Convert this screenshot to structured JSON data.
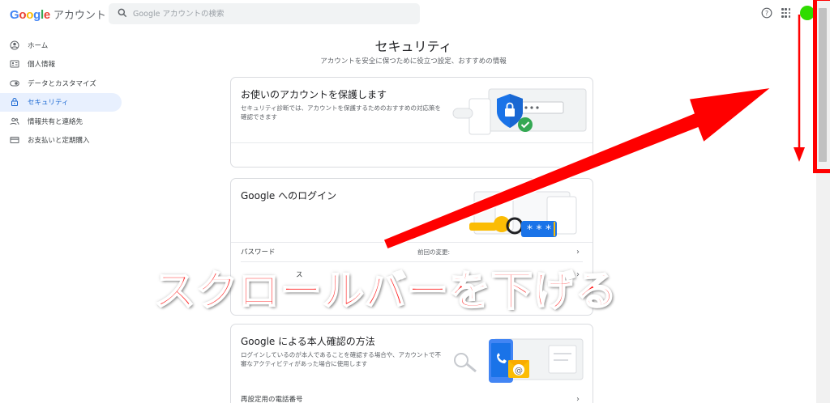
{
  "header": {
    "logo_google": "Google",
    "logo_account": "アカウント",
    "search_placeholder": "Google アカウントの検索"
  },
  "sidebar": {
    "items": [
      {
        "label": "ホーム",
        "icon": "home-icon"
      },
      {
        "label": "個人情報",
        "icon": "id-card-icon"
      },
      {
        "label": "データとカスタマイズ",
        "icon": "toggle-icon"
      },
      {
        "label": "セキュリティ",
        "icon": "lock-icon",
        "active": true
      },
      {
        "label": "情報共有と連絡先",
        "icon": "people-icon"
      },
      {
        "label": "お支払いと定期購入",
        "icon": "credit-card-icon"
      }
    ]
  },
  "main": {
    "title": "セキュリティ",
    "subtitle": "アカウントを安全に保つために役立つ設定、おすすめの情報",
    "cards": [
      {
        "title": "お使いのアカウントを保護します",
        "description": "セキュリティ診断では、アカウントを保護するためのおすすめの対応策を確認できます"
      },
      {
        "title": "Google へのログイン",
        "rows": [
          {
            "label": "パスワード",
            "value": "前回の変更:"
          },
          {
            "label": "ス",
            "value": ""
          }
        ]
      },
      {
        "title": "Google による本人確認の方法",
        "description": "ログインしているのが本人であることを確認する場合や、アカウントで不審なアクティビティがあった場合に使用します",
        "rows": [
          {
            "label": "再設定用の電話番号",
            "value": ""
          }
        ]
      }
    ]
  },
  "annotation": {
    "text": "スクロールバーを下げる",
    "color": "#ff0000"
  },
  "colors": {
    "accent": "#1a73e8",
    "active_bg": "#e8f0fe",
    "avatar": "#2fdc00"
  }
}
